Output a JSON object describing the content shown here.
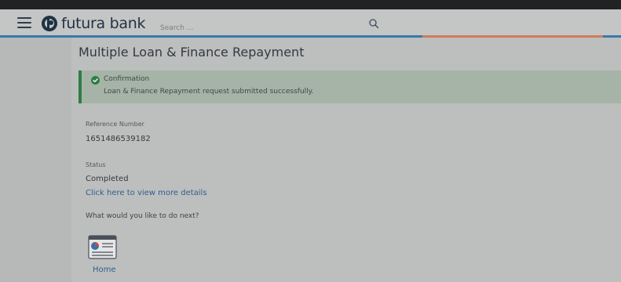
{
  "header": {
    "brand": "futura bank",
    "search_placeholder": "Search ..."
  },
  "page": {
    "title": "Multiple Loan & Finance Repayment",
    "confirmation": {
      "title": "Confirmation",
      "message": "Loan & Finance Repayment request submitted successfully."
    },
    "reference": {
      "label": "Reference Number",
      "value": "1651486539182"
    },
    "status": {
      "label": "Status",
      "value": "Completed"
    },
    "details_link": "Click here to view more details",
    "next_question": "What would you like to do next?",
    "home_label": "Home"
  },
  "colors": {
    "header_bg": "#c4c5c5",
    "accent_blue": "#3a78a8",
    "accent_orange": "#cf7d58",
    "success_green": "#2e7d45",
    "link": "#2e5f8f"
  }
}
